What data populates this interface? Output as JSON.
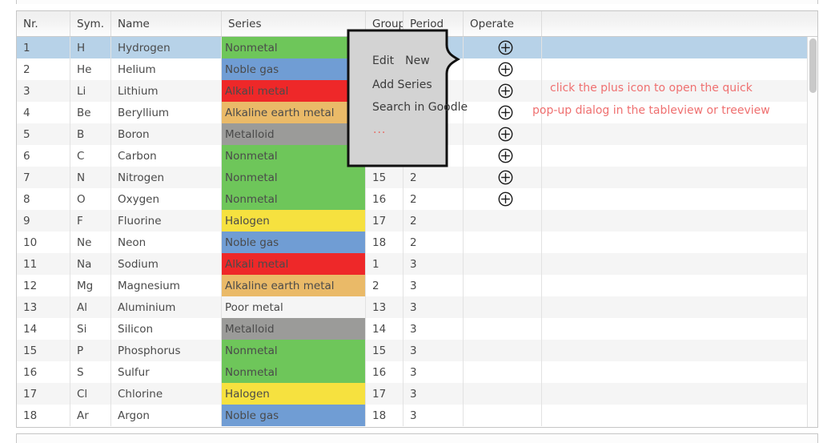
{
  "table": {
    "columns": [
      {
        "key": "nr",
        "label": "Nr."
      },
      {
        "key": "sym",
        "label": "Sym."
      },
      {
        "key": "name",
        "label": "Name"
      },
      {
        "key": "series",
        "label": "Series"
      },
      {
        "key": "group",
        "label": "Group"
      },
      {
        "key": "period",
        "label": "Period"
      },
      {
        "key": "operate",
        "label": "Operate"
      }
    ],
    "series_colors": {
      "Nonmetal": "#6ec65a",
      "Noble gas": "#709dd4",
      "Alkali metal": "#ee2829",
      "Alkaline earth metal": "#eaba68",
      "Metalloid": "#9b9b99",
      "Halogen": "#f6e13f",
      "Poor metal": ""
    },
    "selected_row_index": 0,
    "selection_color": "#b7d2e8",
    "rows": [
      {
        "nr": "1",
        "sym": "H",
        "name": "Hydrogen",
        "series": "Nonmetal",
        "group": "",
        "period": "",
        "operate": "plus-icon"
      },
      {
        "nr": "2",
        "sym": "He",
        "name": "Helium",
        "series": "Noble gas",
        "group": "",
        "period": "",
        "operate": "plus-icon"
      },
      {
        "nr": "3",
        "sym": "Li",
        "name": "Lithium",
        "series": "Alkali metal",
        "group": "",
        "period": "",
        "operate": "plus-icon"
      },
      {
        "nr": "4",
        "sym": "Be",
        "name": "Beryllium",
        "series": "Alkaline earth metal",
        "group": "",
        "period": "",
        "operate": "plus-icon"
      },
      {
        "nr": "5",
        "sym": "B",
        "name": "Boron",
        "series": "Metalloid",
        "group": "",
        "period": "",
        "operate": "plus-icon"
      },
      {
        "nr": "6",
        "sym": "C",
        "name": "Carbon",
        "series": "Nonmetal",
        "group": "",
        "period": "",
        "operate": "plus-icon"
      },
      {
        "nr": "7",
        "sym": "N",
        "name": "Nitrogen",
        "series": "Nonmetal",
        "group": "15",
        "period": "2",
        "operate": "plus-icon"
      },
      {
        "nr": "8",
        "sym": "O",
        "name": "Oxygen",
        "series": "Nonmetal",
        "group": "16",
        "period": "2",
        "operate": "plus-icon"
      },
      {
        "nr": "9",
        "sym": "F",
        "name": "Fluorine",
        "series": "Halogen",
        "group": "17",
        "period": "2",
        "operate": ""
      },
      {
        "nr": "10",
        "sym": "Ne",
        "name": "Neon",
        "series": "Noble gas",
        "group": "18",
        "period": "2",
        "operate": ""
      },
      {
        "nr": "11",
        "sym": "Na",
        "name": "Sodium",
        "series": "Alkali metal",
        "group": "1",
        "period": "3",
        "operate": ""
      },
      {
        "nr": "12",
        "sym": "Mg",
        "name": "Magnesium",
        "series": "Alkaline earth metal",
        "group": "2",
        "period": "3",
        "operate": ""
      },
      {
        "nr": "13",
        "sym": "Al",
        "name": "Aluminium",
        "series": "Poor metal",
        "group": "13",
        "period": "3",
        "operate": ""
      },
      {
        "nr": "14",
        "sym": "Si",
        "name": "Silicon",
        "series": "Metalloid",
        "group": "14",
        "period": "3",
        "operate": ""
      },
      {
        "nr": "15",
        "sym": "P",
        "name": "Phosphorus",
        "series": "Nonmetal",
        "group": "15",
        "period": "3",
        "operate": ""
      },
      {
        "nr": "16",
        "sym": "S",
        "name": "Sulfur",
        "series": "Nonmetal",
        "group": "16",
        "period": "3",
        "operate": ""
      },
      {
        "nr": "17",
        "sym": "Cl",
        "name": "Chlorine",
        "series": "Halogen",
        "group": "17",
        "period": "3",
        "operate": ""
      },
      {
        "nr": "18",
        "sym": "Ar",
        "name": "Argon",
        "series": "Noble gas",
        "group": "18",
        "period": "3",
        "operate": ""
      }
    ]
  },
  "popup": {
    "background": "#d3d3d3",
    "border": "#101010",
    "rows": [
      [
        "Edit",
        "New"
      ],
      [
        "Add Series"
      ],
      [
        "Search in Goodle"
      ],
      [
        "..."
      ]
    ],
    "ellipsis_color": "#e8645c"
  },
  "annotation": {
    "color": "#ef7070",
    "line1": "click the plus icon to open the quick",
    "line2": "pop-up dialog in the tableview or treeview"
  },
  "scrollbar": {
    "thumb_color": "#c9c9c9"
  }
}
